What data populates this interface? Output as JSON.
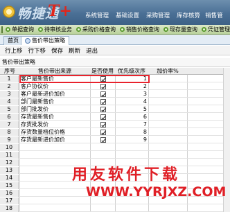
{
  "app": {
    "logo_text": "畅捷通",
    "logo_mark": "T+"
  },
  "top_nav": {
    "items": [
      "系统管理",
      "基础设置",
      "采购管理",
      "库存核算",
      "销售管"
    ]
  },
  "sub_nav": {
    "items": [
      "单据查询",
      "待审核业务",
      "采购价格查询",
      "销售价格查询",
      "现存量查询",
      "凭证管理"
    ]
  },
  "tabs": [
    {
      "label": "首页",
      "active": false
    },
    {
      "label": "售价带出策略",
      "active": true
    }
  ],
  "toolbar": {
    "buttons": [
      "行上移",
      "行下移",
      "保存",
      "刷新",
      "退出"
    ]
  },
  "panel": {
    "title": "售价带出策略"
  },
  "table": {
    "columns": [
      "序号",
      "售价带出来源",
      "是否使用",
      "优先级次序",
      "加价率%"
    ],
    "rows": [
      {
        "no": "1",
        "source": "客户最新售价",
        "enabled": true,
        "priority": "1",
        "markup": ""
      },
      {
        "no": "2",
        "source": "客户协议价",
        "enabled": true,
        "priority": "2",
        "markup": ""
      },
      {
        "no": "3",
        "source": "客户最新进价加价",
        "enabled": true,
        "priority": "3",
        "markup": ""
      },
      {
        "no": "4",
        "source": "部门最新售价",
        "enabled": true,
        "priority": "4",
        "markup": ""
      },
      {
        "no": "5",
        "source": "部门批发价",
        "enabled": true,
        "priority": "5",
        "markup": ""
      },
      {
        "no": "6",
        "source": "存货最新售价",
        "enabled": true,
        "priority": "6",
        "markup": ""
      },
      {
        "no": "7",
        "source": "存货批发价",
        "enabled": true,
        "priority": "7",
        "markup": ""
      },
      {
        "no": "8",
        "source": "存货数量档位价格",
        "enabled": true,
        "priority": "8",
        "markup": ""
      },
      {
        "no": "9",
        "source": "存货最新进价加价",
        "enabled": true,
        "priority": "9",
        "markup": ""
      }
    ],
    "empty_row_numbers": [
      "10",
      "11",
      "12",
      "13",
      "14",
      "15",
      "16",
      "17",
      "18",
      "19"
    ],
    "selected_row": 1
  },
  "watermark": {
    "title": "用友软件下载",
    "url": "WWW.YYRJXZ.COM"
  },
  "colors": {
    "banner": "#4a6f95",
    "subnav": "#c9dcb0",
    "highlight": "#e8232d",
    "watermark": "#e01f26"
  }
}
